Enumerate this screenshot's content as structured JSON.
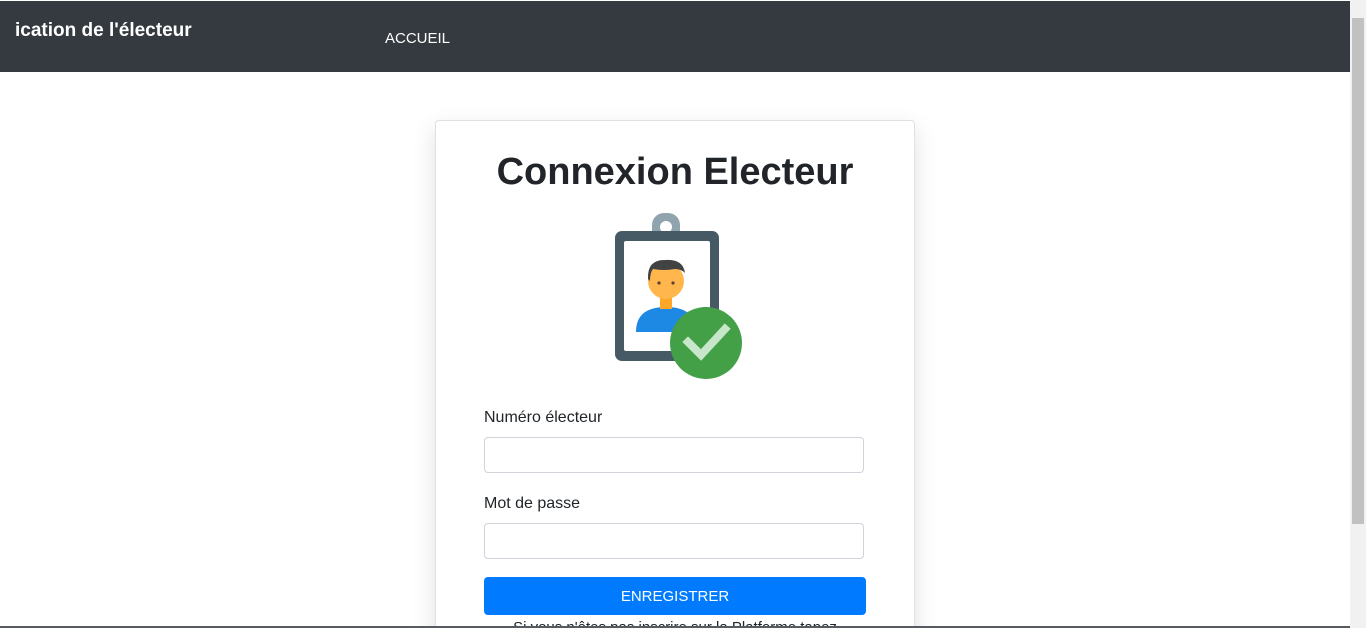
{
  "navbar": {
    "brand": "ication de l'électeur",
    "links": [
      {
        "label": "ACCUEIL"
      }
    ]
  },
  "login_card": {
    "title": "Connexion Electeur",
    "illustration_icon": "voter-id-badge-check-icon",
    "fields": {
      "voter_number": {
        "label": "Numéro électeur",
        "value": ""
      },
      "password": {
        "label": "Mot de passe",
        "value": ""
      }
    },
    "submit_label": "ENREGISTRER",
    "footnote": "Si vous n'êtes pas inscrire sur la Platforme tapez"
  },
  "colors": {
    "navbar_bg": "#343a40",
    "primary": "#007bff",
    "check_green": "#43a047"
  }
}
